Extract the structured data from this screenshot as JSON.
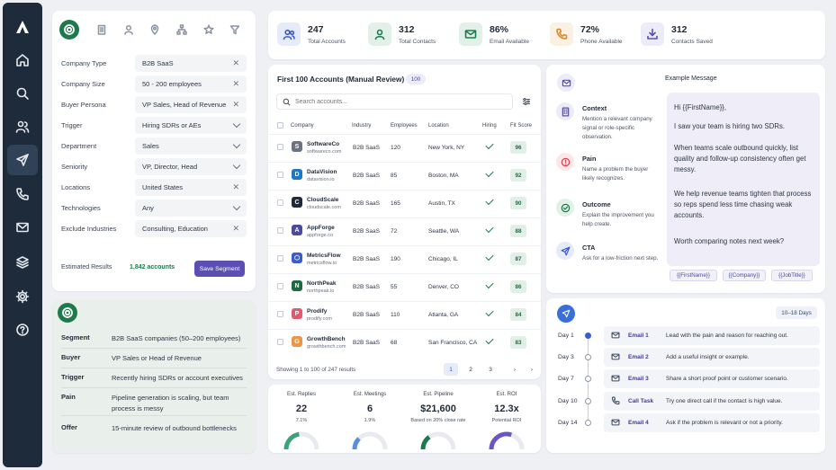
{
  "nav": {
    "items": [
      "home",
      "search",
      "users",
      "send",
      "phone",
      "mail",
      "layers",
      "settings",
      "help"
    ]
  },
  "filters": {
    "rows": [
      {
        "label": "Company Type",
        "value": "B2B SaaS",
        "control": "clear"
      },
      {
        "label": "Company Size",
        "value": "50 - 200 employees",
        "control": "clear"
      },
      {
        "label": "Buyer Persona",
        "value": "VP Sales, Head of Revenue",
        "control": "clear"
      },
      {
        "label": "Trigger",
        "value": "Hiring SDRs or AEs",
        "control": "dropdown"
      },
      {
        "label": "Department",
        "value": "Sales",
        "control": "dropdown"
      },
      {
        "label": "Seniority",
        "value": "VP, Director, Head",
        "control": "dropdown"
      },
      {
        "label": "Locations",
        "value": "United States",
        "control": "clear"
      },
      {
        "label": "Technologies",
        "value": "Any",
        "control": "dropdown"
      },
      {
        "label": "Exclude Industries",
        "value": "Consulting, Education",
        "control": "clear"
      }
    ],
    "estimated_label": "Estimated Results",
    "estimated_value": "1,842 accounts",
    "save_label": "Save Segment"
  },
  "summary": {
    "rows": [
      {
        "key": "Segment",
        "value": "B2B SaaS companies (50–200 employees)"
      },
      {
        "key": "Buyer",
        "value": "VP Sales or Head of Revenue"
      },
      {
        "key": "Trigger",
        "value": "Recently hiring SDRs or account executives"
      },
      {
        "key": "Pain",
        "value": "Pipeline generation is scaling, but team process is messy"
      },
      {
        "key": "Offer",
        "value": "15-minute review of outbound bottlenecks"
      }
    ]
  },
  "stats": [
    {
      "value": "247",
      "label": "Total Accounts",
      "icon": "users-icon",
      "color": "#3a5ccc",
      "bg": "#e6ebfa"
    },
    {
      "value": "312",
      "label": "Total Contacts",
      "icon": "contact-icon",
      "color": "#1e7a4d",
      "bg": "#e2f1e8"
    },
    {
      "value": "86%",
      "label": "Email Available",
      "icon": "mail-icon",
      "color": "#1e7a4d",
      "bg": "#e2f1e8"
    },
    {
      "value": "72%",
      "label": "Phone Available",
      "icon": "phone-icon",
      "color": "#d98a2b",
      "bg": "#fbf0e2"
    },
    {
      "value": "312",
      "label": "Contacts Saved",
      "icon": "download-icon",
      "color": "#5b4fb3",
      "bg": "#ecebf8"
    }
  ],
  "accounts": {
    "title": "First 100 Accounts (Manual Review)",
    "badge": "100",
    "search_placeholder": "Search accounts...",
    "columns": [
      "Company",
      "Industry",
      "Employees",
      "Location",
      "Hiring",
      "Fit Score"
    ],
    "rows": [
      {
        "name": "SoftwareCo",
        "domain": "softwareco.com",
        "letter": "S",
        "logo_color": "#6b7380",
        "industry": "B2B SaaS",
        "employees": "120",
        "location": "New York, NY",
        "hiring": true,
        "score": "96"
      },
      {
        "name": "DataVision",
        "domain": "datavision.io",
        "letter": "D",
        "logo_color": "#1f76c2",
        "industry": "B2B SaaS",
        "employees": "85",
        "location": "Boston, MA",
        "hiring": true,
        "score": "92"
      },
      {
        "name": "CloudScale",
        "domain": "cloudscale.com",
        "letter": "C",
        "logo_color": "#1f2937",
        "industry": "B2B SaaS",
        "employees": "165",
        "location": "Austin, TX",
        "hiring": true,
        "score": "90"
      },
      {
        "name": "AppForge",
        "domain": "appforge.co",
        "letter": "A",
        "logo_color": "#4b4aa0",
        "industry": "B2B SaaS",
        "employees": "72",
        "location": "Seattle, WA",
        "hiring": true,
        "score": "88"
      },
      {
        "name": "MetricsFlow",
        "domain": "metricsflow.io",
        "letter": "⬡",
        "logo_color": "#3a5ccc",
        "industry": "B2B SaaS",
        "employees": "190",
        "location": "Chicago, IL",
        "hiring": true,
        "score": "87"
      },
      {
        "name": "NorthPeak",
        "domain": "northpeak.io",
        "letter": "N",
        "logo_color": "#1e6b43",
        "industry": "B2B SaaS",
        "employees": "55",
        "location": "Denver, CO",
        "hiring": true,
        "score": "86"
      },
      {
        "name": "Prodify",
        "domain": "prodify.com",
        "letter": "P",
        "logo_color": "#e05a6d",
        "industry": "B2B SaaS",
        "employees": "110",
        "location": "Atlanta, GA",
        "hiring": true,
        "score": "84"
      },
      {
        "name": "GrowthBench",
        "domain": "growthbench.com",
        "letter": "G",
        "logo_color": "#e8964a",
        "industry": "B2B SaaS",
        "employees": "68",
        "location": "San Francisco, CA",
        "hiring": true,
        "score": "83"
      }
    ],
    "footer": "Showing 1 to 100 of 247 results",
    "pages": [
      "1",
      "2",
      "3"
    ]
  },
  "metrics": [
    {
      "label": "Est. Replies",
      "value": "22",
      "sub": "7.1%",
      "fraction": 0.45,
      "color": "#3aa37a"
    },
    {
      "label": "Est. Meetings",
      "value": "6",
      "sub": "1.9%",
      "fraction": 0.25,
      "color": "#5a8fd6"
    },
    {
      "label": "Est. Pipeline",
      "value": "$21,600",
      "sub": "Based on 20% close rate",
      "fraction": 0.3,
      "color": "#1e7a4d"
    },
    {
      "label": "Est. ROI",
      "value": "12.3x",
      "sub": "Potential ROI",
      "fraction": 0.6,
      "color": "#6a55c2"
    }
  ],
  "framework": [
    {
      "title": "Context",
      "desc": "Mention a relevant company signal or role-specific observation.",
      "icon": "building-icon",
      "color": "#5b4fb3",
      "bg": "#ecebf8"
    },
    {
      "title": "Pain",
      "desc": "Name a problem the buyer likely recognizes.",
      "icon": "alert-icon",
      "color": "#d9434f",
      "bg": "#fbe7e8"
    },
    {
      "title": "Outcome",
      "desc": "Explain the improvement you help create.",
      "icon": "check-circle-icon",
      "color": "#1e7a4d",
      "bg": "#e2f1e8"
    },
    {
      "title": "CTA",
      "desc": "Ask for a low-friction next step.",
      "icon": "send-icon",
      "color": "#3a5ccc",
      "bg": "#e6ebfa"
    }
  ],
  "message": {
    "title": "Example Message",
    "paragraphs": [
      "Hi {{FirstName}},",
      "I saw your team is hiring two SDRs.",
      "When teams scale outbound quickly, list quality and follow-up consistency often get messy.",
      "We help revenue teams tighten that process so reps spend less time chasing weak accounts.",
      "Worth comparing notes next week?"
    ],
    "tags": [
      "{{FirstName}}",
      "{{Company}}",
      "{{JobTitle}}"
    ]
  },
  "sequence": {
    "badge": "10–18 Days",
    "steps": [
      {
        "day": "Day 1",
        "label": "Email 1",
        "desc": "Lead with the pain and reason for reaching out.",
        "icon": "mail-icon"
      },
      {
        "day": "Day 3",
        "label": "Email 2",
        "desc": "Add a useful insight or example.",
        "icon": "mail-icon"
      },
      {
        "day": "Day 7",
        "label": "Email 3",
        "desc": "Share a short proof point or customer scenario.",
        "icon": "mail-icon"
      },
      {
        "day": "Day 10",
        "label": "Call Task",
        "desc": "Try one direct call if the contact is high value.",
        "icon": "phone-icon"
      },
      {
        "day": "Day 14",
        "label": "Email 4",
        "desc": "Ask if the problem is relevant or not a priority.",
        "icon": "mail-icon"
      }
    ]
  }
}
